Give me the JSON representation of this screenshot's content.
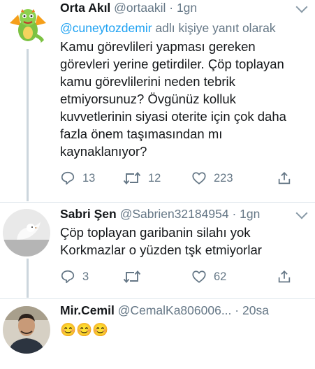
{
  "tweets": [
    {
      "name": "Orta Akıl",
      "handle": "@ortaakil",
      "time": "1gn",
      "replying_prefix": "@cuneytozdemir",
      "replying_suffix": "adlı kişiye yanıt olarak",
      "lines": [
        "Kamu görevlileri yapması gereken",
        "görevleri yerine getirdiler. Çöp toplayan",
        "kamu görevlilerini neden tebrik",
        "etmiyorsunuz? Övgünüz kolluk",
        "kuvvetlerinin siyasi oterite için çok daha",
        "fazla önem taşımasından mı",
        "kaynaklanıyor?"
      ],
      "replies": "13",
      "retweets": "12",
      "likes": "223"
    },
    {
      "name": "Sabri Şen",
      "handle": "@Sabrien32184954",
      "time": "1gn",
      "lines": [
        "Çöp toplayan garibanin silahı yok",
        "Korkmazlar o yüzden tşk etmiyorlar"
      ],
      "replies": "3",
      "retweets": "",
      "likes": "62"
    },
    {
      "name": "Mir.Cemil",
      "handle": "@CemalKa806006...",
      "time": "20sa",
      "lines": [
        "😊😊😊"
      ]
    }
  ],
  "separator": "·",
  "icons": {
    "reply": "reply-icon",
    "retweet": "retweet-icon",
    "like": "like-icon",
    "menu": "chevron-down-icon"
  },
  "colors": {
    "text": "#14171a",
    "secondary": "#657786",
    "link": "#1da1f2",
    "thread_line": "#ccd6dd",
    "divider": "#e1e8ed"
  }
}
